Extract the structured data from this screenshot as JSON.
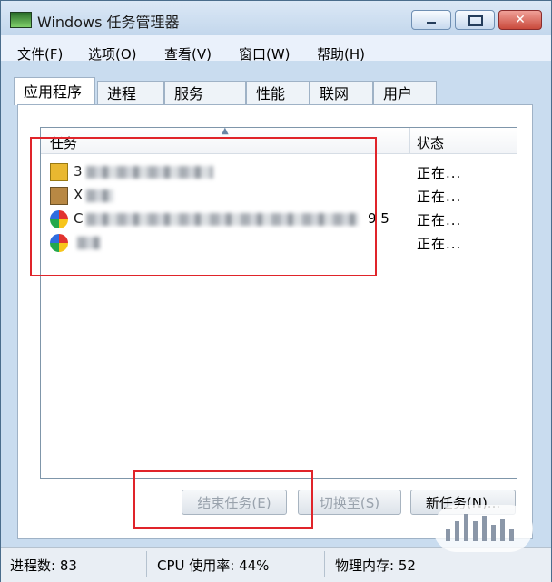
{
  "window": {
    "title": "Windows 任务管理器"
  },
  "menu": [
    "文件(F)",
    "选项(O)",
    "查看(V)",
    "窗口(W)",
    "帮助(H)"
  ],
  "tabs": [
    "应用程序",
    "进程",
    "服务",
    "性能",
    "联网",
    "用户"
  ],
  "task_list": {
    "headers": [
      "任务",
      "状态"
    ],
    "rows": [
      {
        "icon": "folder-icon",
        "name": "3",
        "suffix": "",
        "status": "正在..."
      },
      {
        "icon": "package-icon",
        "name": "X",
        "suffix": "",
        "status": "正在..."
      },
      {
        "icon": "color-ball-icon",
        "name": "C",
        "suffix": "9 5",
        "status": "正在..."
      },
      {
        "icon": "color-ball-icon",
        "name": "",
        "suffix": "",
        "status": "正在..."
      }
    ]
  },
  "buttons": {
    "end_task": "结束任务(E)",
    "switch_to": "切换至(S)",
    "new_task": "新任务(N)..."
  },
  "statusbar": {
    "processes": "进程数: 83",
    "cpu": "CPU 使用率: 44%",
    "memory": "物理内存: 52"
  },
  "colors": {
    "annotation_red": "#e0242a"
  }
}
